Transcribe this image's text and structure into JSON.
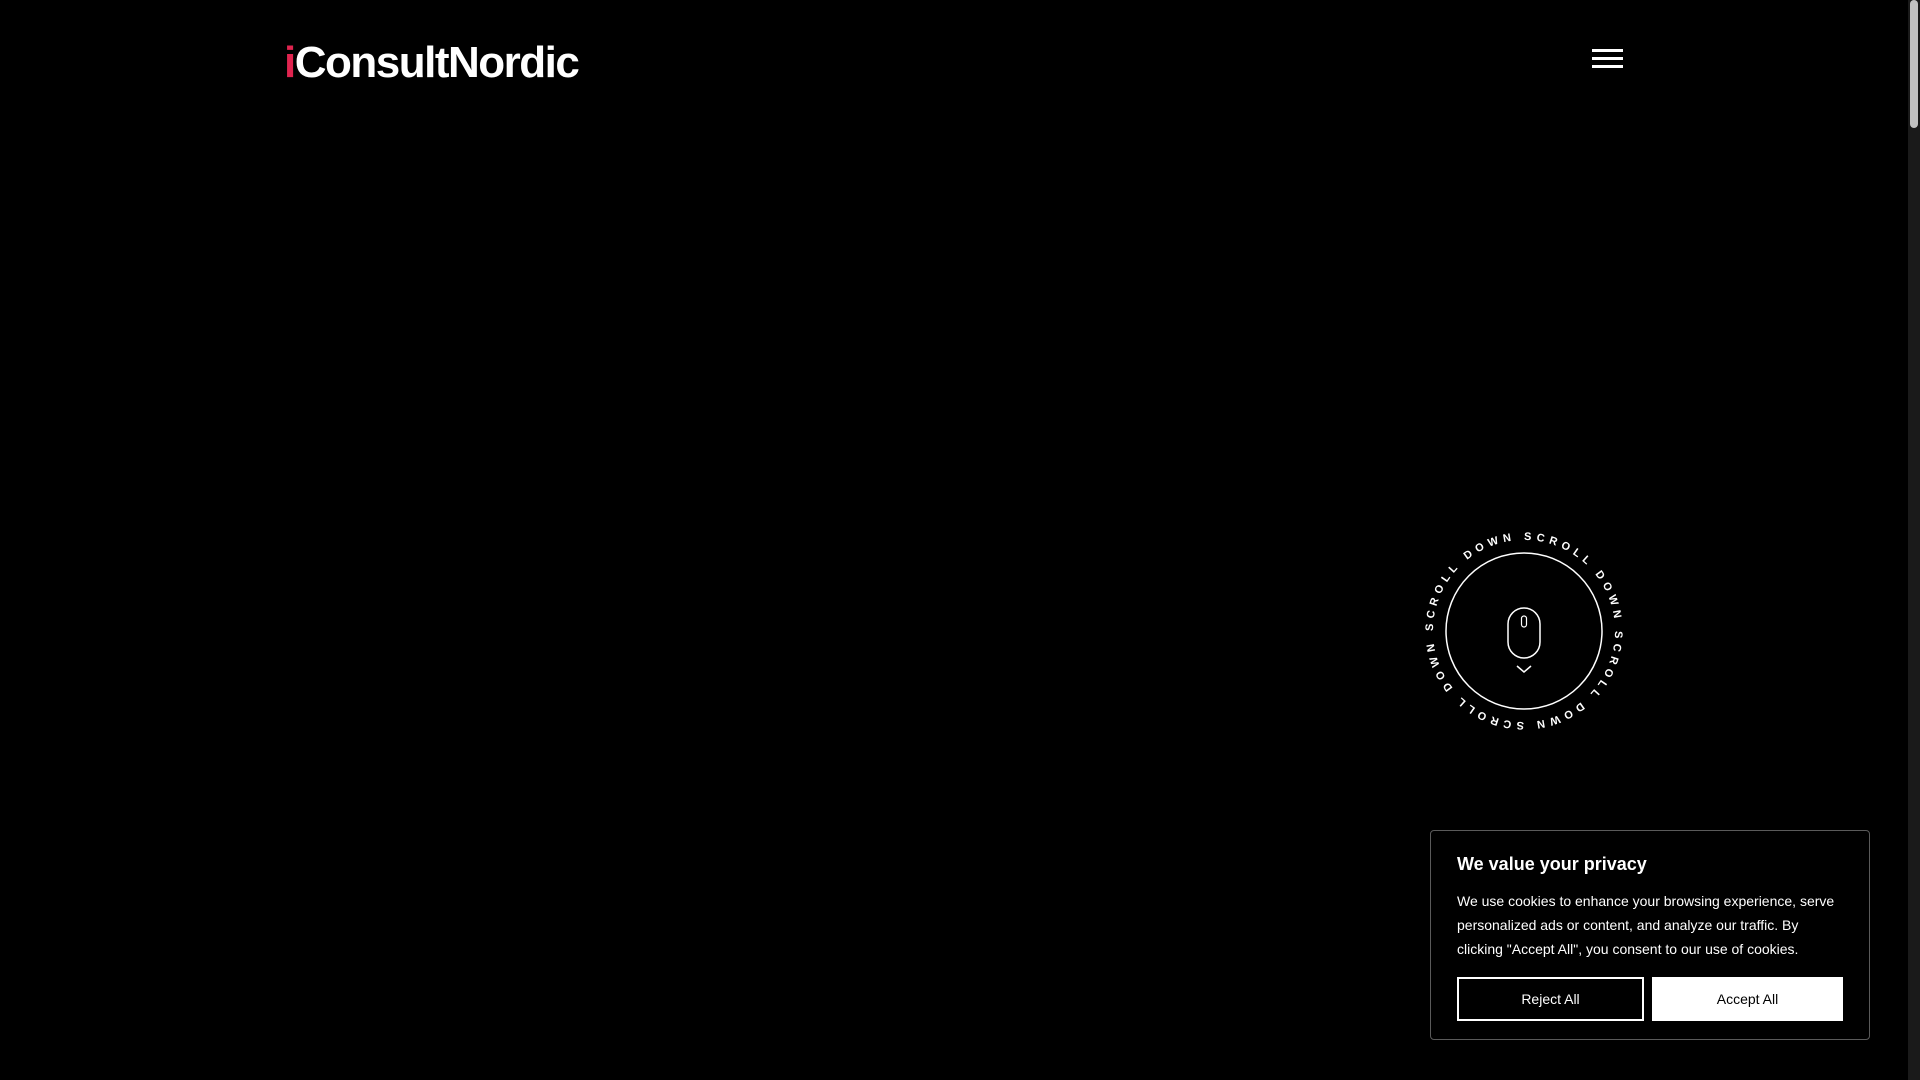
{
  "header": {
    "logo_first": "i",
    "logo_rest": "ConsultNordic",
    "menu_icon": "hamburger-menu-icon"
  },
  "scroll_indicator": {
    "ring_text": "SCROLL DOWN SCROLL DOWN SCROLL DOWN SCROLL DOWN",
    "mouse_icon": "mouse-icon",
    "arrow_icon": "chevron-down-icon"
  },
  "cookie_banner": {
    "title": "We value your privacy",
    "text": "We use cookies to enhance your browsing experience, serve personalized ads or content, and analyze our traffic. By clicking \"Accept All\", you consent to our use of cookies.",
    "reject_label": "Reject All",
    "accept_label": "Accept All"
  },
  "colors": {
    "background": "#000000",
    "brand_accent": "#e0244f",
    "foreground": "#ffffff"
  }
}
